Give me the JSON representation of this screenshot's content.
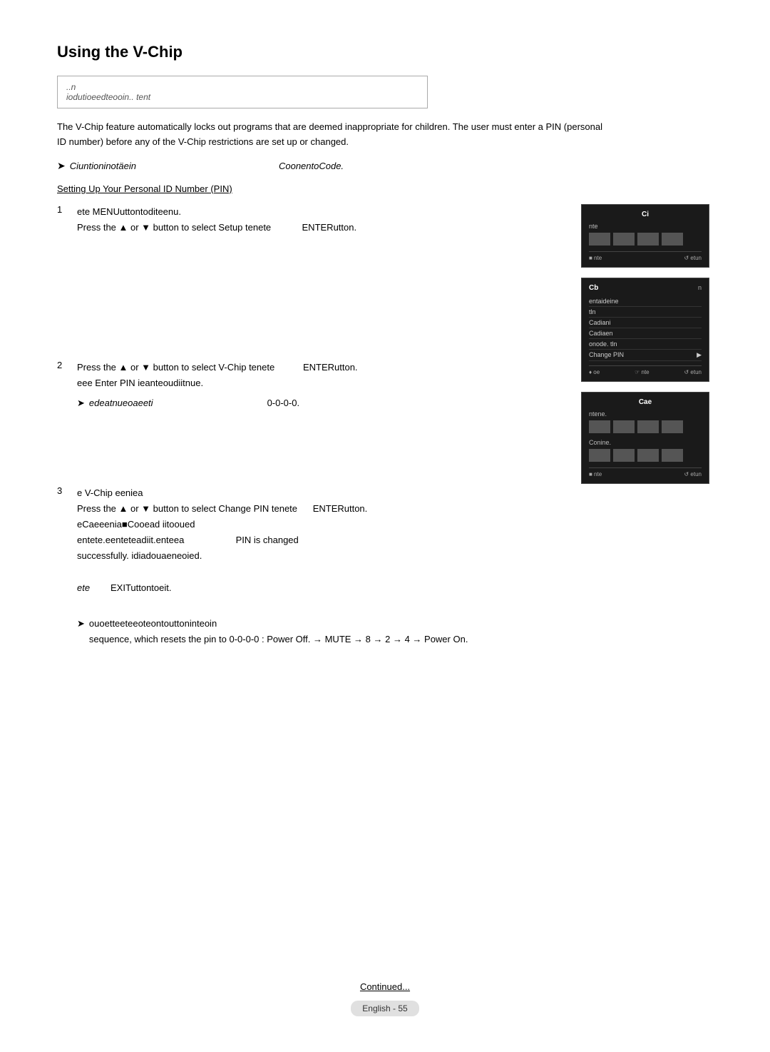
{
  "page": {
    "title": "Using the V-Chip",
    "info_box_line1": "..n",
    "info_box_line2": "iodutioeedteooin.. tent",
    "description": "The V-Chip feature automatically locks out programs that are deemed inappropriate for children. The user must enter a PIN (personal ID number) before any of the V-Chip restrictions are set up or changed.",
    "tip1_text": "Ciuntioninotäein",
    "tip1_right": "CoonentoCode.",
    "section_title": "Setting Up Your Personal ID Number (PIN)",
    "steps": [
      {
        "number": "1",
        "text": "ete   MENUuttontoditeenu.",
        "text2": "Press the ▲ or ▼ button to select Setup tenete",
        "text3": "ENTERutton."
      },
      {
        "number": "2",
        "text": "Press the ▲ or ▼ button to select V-Chip tenete",
        "text_right": "ENTERutton.",
        "text2": "eee          Enter PIN ieanteoudiitnue.",
        "tip_arrow": "➤",
        "tip_text": "edeatnueoaeeti",
        "tip_right": "0-0-0-0."
      },
      {
        "number": "3",
        "text": "e   V-Chip eeniea",
        "text2": "Press the ▲ or ▼ button to select Change PIN tenete",
        "text2_right": "ENTERutton.",
        "text3": "eCaeeenia■Cooead iitooued",
        "text4": "entete.eenteteadiit.enteea",
        "text4_right": "PIN is changed",
        "text5": "successfully.  idiadouaeneoied.",
        "text6_label": "ete",
        "text6": "EXITuttontoeit.",
        "tip2_arrow": "➤",
        "tip2_text": "ouoetteeteeoteontouttoninteoin",
        "tip2_cont": "sequence, which resets the pin to 0-0-0-0 : Power Off. → MUTE → 8 → 2 → 4 → Power On."
      }
    ],
    "panels": {
      "panel1": {
        "title": "Ci",
        "label": "nte",
        "footer_enter": "■ nte",
        "footer_return": "↺ etun"
      },
      "panel2": {
        "title_left": "Cb",
        "title_right": "n",
        "items": [
          "entaideine",
          "tln",
          "Cadiani",
          "Cadiaen",
          "onode. tln"
        ],
        "selected_item": "Change PIN",
        "footer_move": "♦ oe",
        "footer_enter": "☞ nte",
        "footer_return": "↺ etun"
      },
      "panel3": {
        "title": "Cae",
        "label_new": "ntene.",
        "label_confirm": "Conine.",
        "footer_enter": "■ nte",
        "footer_return": "↺ etun"
      }
    },
    "footer": {
      "continued": "Continued...",
      "language": "English",
      "page_number": "55"
    }
  }
}
